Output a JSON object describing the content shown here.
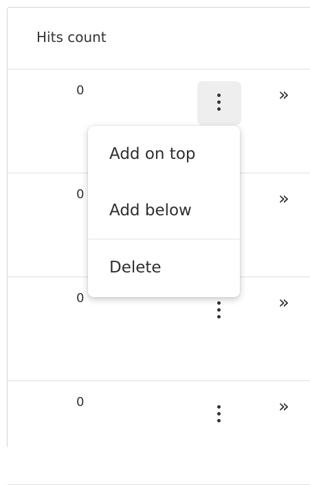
{
  "table": {
    "header": "Hits count",
    "rows": [
      {
        "count": "0",
        "expand": "»"
      },
      {
        "count": "0",
        "expand": "»"
      },
      {
        "count": "0",
        "expand": "»"
      },
      {
        "count": "0",
        "expand": "»"
      }
    ]
  },
  "context_menu": {
    "items": [
      {
        "label": "Add on top"
      },
      {
        "label": "Add below"
      },
      {
        "label": "Delete"
      }
    ]
  },
  "icons": {
    "row_menu": "more-vertical-icon",
    "row_expand": "double-chevron-right-icon"
  }
}
